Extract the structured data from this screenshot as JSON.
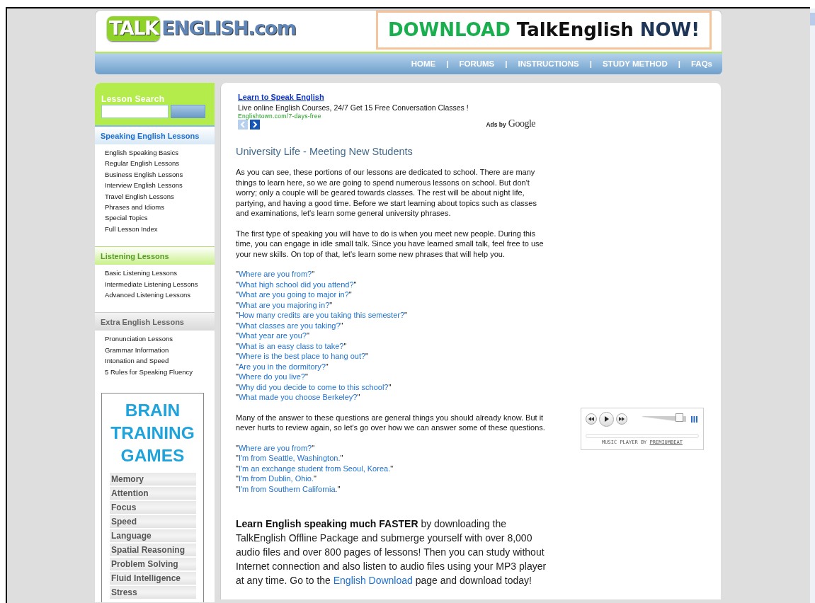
{
  "header": {
    "logo": [
      "TALK",
      "ENGLISH.com"
    ],
    "banner": [
      "DOWNLOAD",
      "TalkEnglish",
      "NOW!"
    ],
    "nav": [
      {
        "label": "HOME"
      },
      {
        "label": "FORUMS"
      },
      {
        "label": "INSTRUCTIONS"
      },
      {
        "label": "STUDY METHOD"
      },
      {
        "label": "FAQs"
      }
    ],
    "nav_separator": "|"
  },
  "sidebar": {
    "search": {
      "title": "Lesson Search"
    },
    "sections": [
      {
        "kind": "blue",
        "title": "Speaking English Lessons",
        "items": [
          "English Speaking Basics",
          "Regular English Lessons",
          "Business English Lessons",
          "Interview English Lessons",
          "Travel English Lessons",
          "Phrases and Idioms",
          "Special Topics",
          "Full Lesson Index"
        ]
      },
      {
        "kind": "green",
        "title": "Listening Lessons",
        "items": [
          "Basic Listening Lessons",
          "Intermediate Listening Lessons",
          "Advanced Listening Lessons"
        ]
      },
      {
        "kind": "gray",
        "title": "Extra English Lessons",
        "items": [
          "Pronunciation Lessons",
          "Grammar Information",
          "Intonation and Speed",
          "5 Rules for Speaking Fluency"
        ]
      }
    ],
    "brain": {
      "title": [
        "BRAIN",
        "TRAINING",
        "GAMES"
      ],
      "items": [
        "Memory",
        "Attention",
        "Focus",
        "Speed",
        "Language",
        "Spatial Reasoning",
        "Problem Solving",
        "Fluid Intelligence",
        "Stress"
      ]
    }
  },
  "ad": {
    "link": "Learn to Speak English",
    "text": "Live online English Courses, 24/7 Get 15 Free Conversation Classes !",
    "url": "Englishtown.com/7-days-free",
    "arrows": [
      {
        "disabled": true
      },
      {
        "disabled": false
      }
    ],
    "ads_by": "Ads by",
    "google": "Google"
  },
  "article": {
    "title": "University Life - Meeting New Students",
    "quote": "\"",
    "blocks": [
      {
        "kind": "paragraph",
        "text": "As you can see, these portions of our lessons are dedicated to school. There are many things to learn here, so we are going to spend numerous lessons on school. But don't worry; only a couple will be geared towards classes. The rest will be about night life, partying, and having a good time. Before we start learning about topics such as classes and examinations, let's learn some general university phrases."
      },
      {
        "kind": "paragraph",
        "text": "The first type of speaking you will have to do is when you meet new people. During this time, you can engage in idle small talk. Since you have learned small talk, feel free to use your new skills. On top of that, let's learn some new phrases that will help you."
      },
      {
        "kind": "phrases",
        "items": [
          "Where are you from?",
          "What high school did you attend?",
          "What are you going to major in?",
          "What are you majoring in?",
          "How many credits are you taking this semester?",
          "What classes are you taking?",
          "What year are you?",
          "What is an easy class to take?",
          "Where is the best place to hang out?",
          "Are you in the dormitory?",
          "Where do you live?",
          "Why did you decide to come to this school?",
          "What made you choose Berkeley?"
        ]
      },
      {
        "kind": "paragraph_player",
        "text": "Many of the answer to these questions are general things you should already know. But it never hurts to review again, so let's go over how we can answer some of these questions."
      },
      {
        "kind": "phrases",
        "items": [
          "Where are you from?",
          "I'm from Seattle, Washington.",
          "I'm an exchange student from Seoul, Korea.",
          "I'm from Dublin, Ohio.",
          "I'm from Southern California."
        ]
      }
    ],
    "promo": {
      "before": "**Learn English speaking much FASTER** by downloading the TalkEnglish Offline Package and submerge yourself with over 8,000 audio files and over 800 pages of lessons! Then you can study without Internet connection and also listen to audio files using your MP3 player at any time. Go to the ",
      "link": "English Download",
      "after": " page and download today!"
    }
  },
  "player": {
    "volume": {
      "level": 0.86
    },
    "progress": {
      "level": 0
    },
    "caption": "MUSIC PLAYER BY",
    "brand": "PREMIUMBEAT"
  }
}
